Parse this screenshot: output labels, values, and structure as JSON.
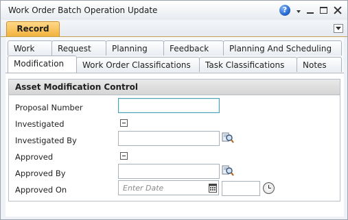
{
  "window": {
    "title": "Work Order Batch Operation Update"
  },
  "ribbon": {
    "active_tab": "Record"
  },
  "tabs": {
    "row1": [
      "Work",
      "Request",
      "Planning",
      "Feedback",
      "Planning And Scheduling"
    ],
    "row2": [
      "Modification",
      "Work Order Classifications",
      "Task Classifications",
      "Notes"
    ],
    "active": "Modification"
  },
  "group": {
    "title": "Asset Modification Control",
    "fields": {
      "proposal_number": {
        "label": "Proposal Number",
        "value": ""
      },
      "investigated": {
        "label": "Investigated"
      },
      "investigated_by": {
        "label": "Investigated By",
        "value": ""
      },
      "approved": {
        "label": "Approved"
      },
      "approved_by": {
        "label": "Approved By",
        "value": ""
      },
      "approved_on": {
        "label": "Approved On",
        "date_placeholder": "Enter Date",
        "time_value": ""
      }
    }
  },
  "icons": {
    "help": "help-icon",
    "lookup": "magnifier-lookup-icon",
    "calendar": "calendar-icon",
    "clock": "clock-icon"
  },
  "colors": {
    "record_tab": "#f3b33d",
    "focus_border": "#4d9fb4"
  }
}
